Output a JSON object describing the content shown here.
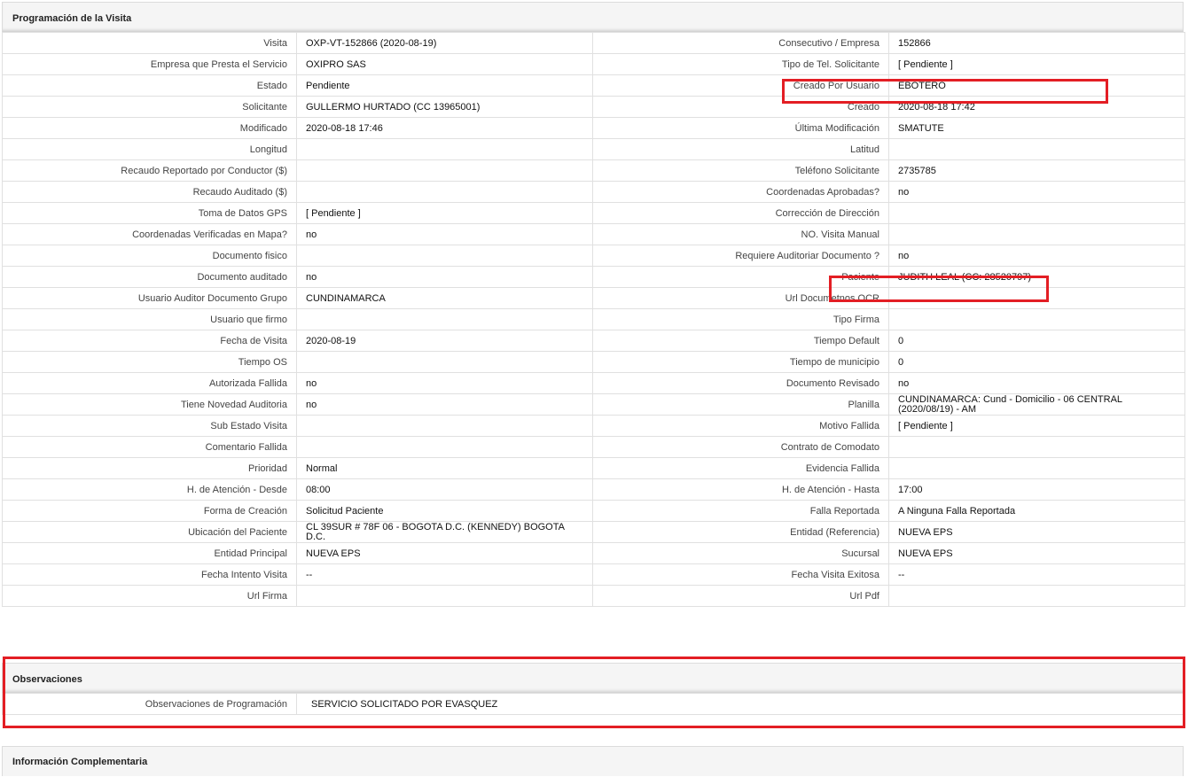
{
  "section_programacion": {
    "title": "Programación de la Visita",
    "rows": [
      {
        "l1": "Visita",
        "v1": "OXP-VT-152866 (2020-08-19)",
        "l2": "Consecutivo / Empresa",
        "v2": "152866"
      },
      {
        "l1": "Empresa que Presta el Servicio",
        "v1": "OXIPRO SAS",
        "l2": "Tipo de Tel. Solicitante",
        "v2": "[ Pendiente ]"
      },
      {
        "l1": "Estado",
        "v1": "Pendiente",
        "l2": "Creado Por Usuario",
        "v2": "EBOTERO"
      },
      {
        "l1": "Solicitante",
        "v1": "GULLERMO HURTADO (CC 13965001)",
        "l2": "Creado",
        "v2": "2020-08-18 17:42"
      },
      {
        "l1": "Modificado",
        "v1": "2020-08-18 17:46",
        "l2": "Última Modificación",
        "v2": " SMATUTE"
      },
      {
        "l1": "Longitud",
        "v1": "",
        "l2": "Latitud",
        "v2": ""
      },
      {
        "l1": "Recaudo Reportado por Conductor ($)",
        "v1": "",
        "l2": "Teléfono Solicitante",
        "v2": "2735785"
      },
      {
        "l1": "Recaudo Auditado ($)",
        "v1": "",
        "l2": "Coordenadas Aprobadas?",
        "v2": " no"
      },
      {
        "l1": "Toma de Datos GPS",
        "v1": "[ Pendiente ]",
        "l2": "Corrección de Dirección",
        "v2": ""
      },
      {
        "l1": "Coordenadas Verificadas en Mapa?",
        "v1": " no",
        "l2": "NO. Visita Manual",
        "v2": ""
      },
      {
        "l1": "Documento fisico",
        "v1": "",
        "l2": "Requiere Auditoriar Documento ?",
        "v2": " no"
      },
      {
        "l1": "Documento auditado",
        "v1": " no",
        "l2": "Paciente",
        "v2": "JUDITH LEAL (CC: 28520797)"
      },
      {
        "l1": "Usuario Auditor Documento Grupo",
        "v1": "CUNDINAMARCA",
        "l2": "Url Documetnos OCR",
        "v2": ""
      },
      {
        "l1": "Usuario que firmo",
        "v1": "",
        "l2": "Tipo Firma",
        "v2": ""
      },
      {
        "l1": "Fecha de Visita",
        "v1": " 2020-08-19",
        "l2": "Tiempo Default",
        "v2": "0"
      },
      {
        "l1": "Tiempo OS",
        "v1": "",
        "l2": "Tiempo de municipio",
        "v2": "0"
      },
      {
        "l1": "Autorizada Fallida",
        "v1": " no",
        "l2": "Documento Revisado",
        "v2": " no"
      },
      {
        "l1": "Tiene Novedad Auditoria",
        "v1": " no",
        "l2": "Planilla",
        "v2": "CUNDINAMARCA: Cund - Domicilio - 06 CENTRAL (2020/08/19) - AM"
      },
      {
        "l1": "Sub Estado Visita",
        "v1": "",
        "l2": "Motivo Fallida",
        "v2": "[ Pendiente ]"
      },
      {
        "l1": "Comentario Fallida",
        "v1": "",
        "l2": "Contrato de Comodato",
        "v2": ""
      },
      {
        "l1": "Prioridad",
        "v1": "Normal",
        "l2": "Evidencia Fallida",
        "v2": ""
      },
      {
        "l1": "H. de Atención - Desde",
        "v1": "08:00",
        "l2": "H. de Atención - Hasta",
        "v2": "17:00"
      },
      {
        "l1": "Forma de Creación",
        "v1": "Solicitud Paciente",
        "l2": "Falla Reportada",
        "v2": "A Ninguna Falla Reportada"
      },
      {
        "l1": "Ubicación del Paciente",
        "v1": "CL 39SUR # 78F 06 - BOGOTA D.C. (KENNEDY) BOGOTA D.C.",
        "l2": "Entidad (Referencia)",
        "v2": "NUEVA EPS"
      },
      {
        "l1": "Entidad Principal",
        "v1": "NUEVA EPS",
        "l2": "Sucursal",
        "v2": "NUEVA EPS"
      },
      {
        "l1": "Fecha Intento Visita",
        "v1": " --",
        "l2": "Fecha Visita Exitosa",
        "v2": " --"
      },
      {
        "l1": "Url Firma",
        "v1": "",
        "l2": "Url Pdf",
        "v2": ""
      }
    ]
  },
  "section_observaciones": {
    "title": "Observaciones",
    "label": "Observaciones de Programación",
    "value": "SERVICIO SOLICITADO POR EVASQUEZ"
  },
  "section_info": {
    "title": "Información Complementaria"
  },
  "colors": {
    "highlight": "#e31e24",
    "header_bg": "#f5f5f5",
    "border": "#e0e0e0"
  }
}
